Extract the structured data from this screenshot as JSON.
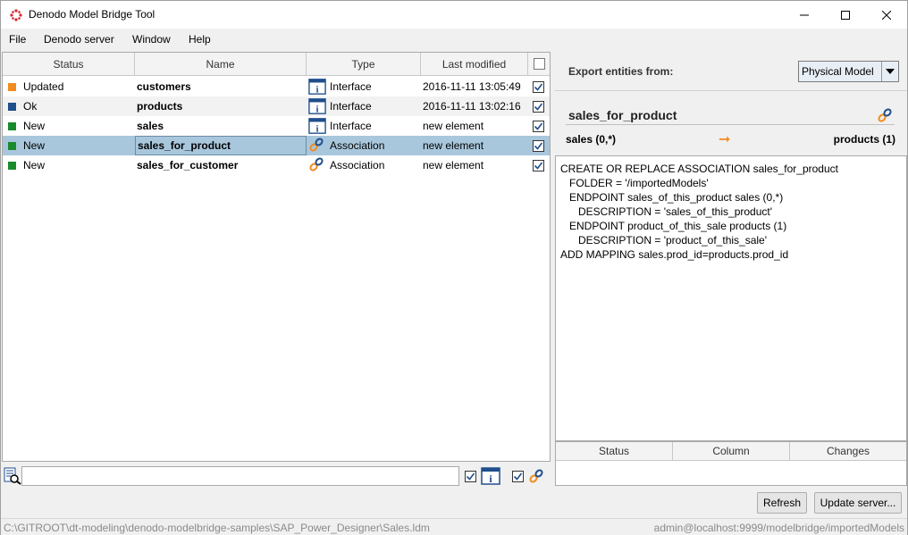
{
  "window": {
    "title": "Denodo Model Bridge Tool"
  },
  "menu": [
    "File",
    "Denodo server",
    "Window",
    "Help"
  ],
  "table": {
    "columns": [
      "Status",
      "Name",
      "Type",
      "Last modified"
    ],
    "rows": [
      {
        "status": "Updated",
        "status_color": "#f28c1e",
        "name": "customers",
        "type": "Interface",
        "type_icon": "interface-icon",
        "modified": "2016-11-11 13:05:49",
        "checked": true
      },
      {
        "status": "Ok",
        "status_color": "#1f4e8c",
        "name": "products",
        "type": "Interface",
        "type_icon": "interface-icon",
        "modified": "2016-11-11 13:02:16",
        "checked": true
      },
      {
        "status": "New",
        "status_color": "#1a8a2e",
        "name": "sales",
        "type": "Interface",
        "type_icon": "interface-icon",
        "modified": "new element",
        "checked": true
      },
      {
        "status": "New",
        "status_color": "#1a8a2e",
        "name": "sales_for_product",
        "type": "Association",
        "type_icon": "association-icon",
        "modified": "new element",
        "checked": true
      },
      {
        "status": "New",
        "status_color": "#1a8a2e",
        "name": "sales_for_customer",
        "type": "Association",
        "type_icon": "association-icon",
        "modified": "new element",
        "checked": true
      }
    ]
  },
  "search": {
    "value": ""
  },
  "export": {
    "label": "Export entities from:",
    "selected": "Physical Model"
  },
  "entity": {
    "name": "sales_for_product",
    "left_end": "sales (0,*)",
    "arrow": "➞",
    "right_end": "products (1)"
  },
  "code": [
    "CREATE OR REPLACE ASSOCIATION sales_for_product",
    "   FOLDER = '/importedModels'",
    "   ENDPOINT sales_of_this_product sales (0,*)",
    "      DESCRIPTION = 'sales_of_this_product'",
    "   ENDPOINT product_of_this_sale products (1)",
    "      DESCRIPTION = 'product_of_this_sale'",
    "ADD MAPPING sales.prod_id=products.prod_id"
  ],
  "changes": {
    "columns": [
      "Status",
      "Column",
      "Changes"
    ]
  },
  "buttons": {
    "refresh": "Refresh",
    "update": "Update server..."
  },
  "statusbar": {
    "path": "C:\\GITROOT\\dt-modeling\\denodo-modelbridge-samples\\SAP_Power_Designer\\Sales.ldm",
    "server": "admin@localhost:9999/modelbridge/importedModels"
  },
  "colors": {
    "selected_row": "#a9c7dc",
    "accent_orange": "#f28c1e",
    "interface_blue": "#1f4e8c"
  }
}
